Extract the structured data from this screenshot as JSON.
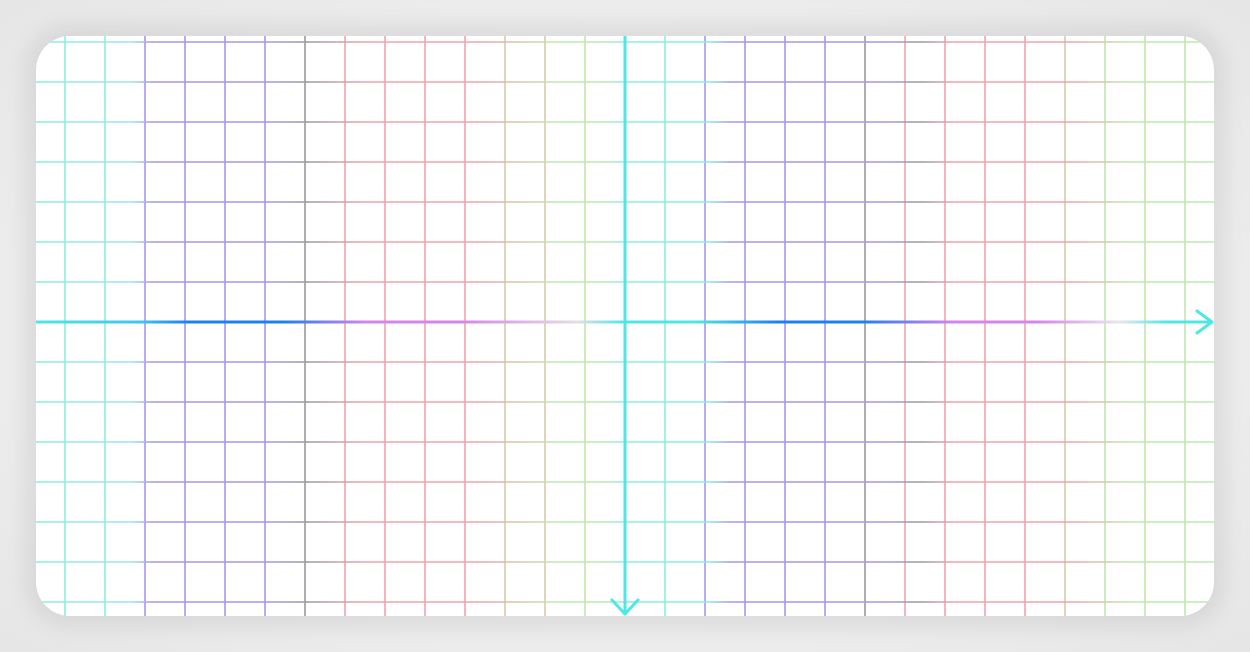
{
  "canvas": {
    "title": "",
    "background": "#ffffff",
    "grid": true
  },
  "palette": {
    "axis": "#4fe6e6",
    "grid_bands": [
      "#7ff0dd",
      "#9a88ee",
      "#8c8c8c",
      "#ee9aa4",
      "#b8e6a6"
    ],
    "axis_gradient": [
      "#4fe6e6",
      "#1e7ff0",
      "#d884ee",
      "#e8e8e8",
      "#4fe6e6"
    ]
  },
  "icons": {
    "x_axis_arrow": "arrow-right-icon",
    "y_axis_arrow": "arrow-down-icon"
  }
}
